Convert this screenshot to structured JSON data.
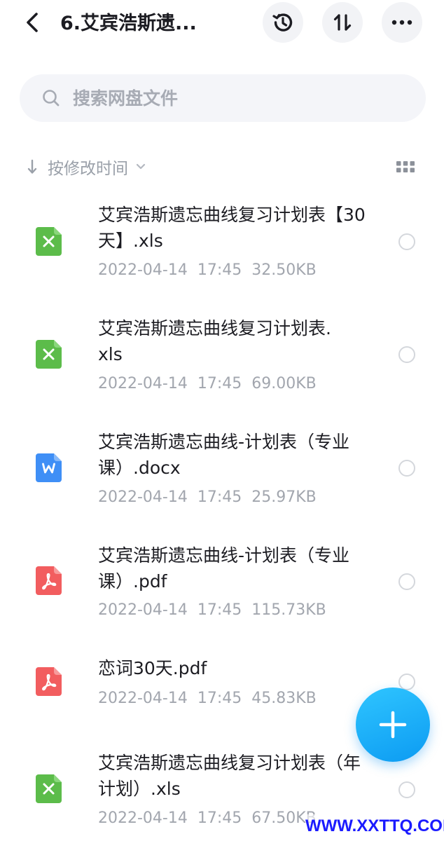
{
  "header": {
    "title": "6.艾宾浩斯遗..."
  },
  "search": {
    "placeholder": "搜索网盘文件"
  },
  "sort": {
    "label": "按修改时间"
  },
  "files": [
    {
      "name": "艾宾浩斯遗忘曲线复习计划表【30天】.xls",
      "meta": "2022-04-14  17:45  32.50KB",
      "type": "xls"
    },
    {
      "name": "艾宾浩斯遗忘曲线复习计划表.xls",
      "meta": "2022-04-14  17:45  69.00KB",
      "type": "xls"
    },
    {
      "name": "艾宾浩斯遗忘曲线-计划表（专业课）.docx",
      "meta": "2022-04-14  17:45  25.97KB",
      "type": "docx"
    },
    {
      "name": "艾宾浩斯遗忘曲线-计划表（专业课）.pdf",
      "meta": "2022-04-14  17:45  115.73KB",
      "type": "pdf"
    },
    {
      "name": "恋词30天.pdf",
      "meta": "2022-04-14  17:45  45.83KB",
      "type": "pdf"
    },
    {
      "name": "艾宾浩斯遗忘曲线复习计划表（年计划）.xls",
      "meta": "2022-04-14  17:45  67.50KB",
      "type": "xls"
    }
  ],
  "icons": {
    "back": "chevron-left-icon",
    "history": "history-icon",
    "sort": "sort-icon",
    "more": "more-icon",
    "search": "search-icon",
    "sort_arrow": "arrow-down-icon",
    "dropdown": "chevron-down-icon",
    "grid": "grid-view-icon",
    "fab": "plus-icon",
    "xls": "excel-file-icon",
    "docx": "word-file-icon",
    "pdf": "pdf-file-icon"
  },
  "colors": {
    "xls": "#5cbc4a",
    "docx": "#3f8ff6",
    "pdf": "#f25d5f",
    "fab": "#16a8f6",
    "watermark": "#1b1bff"
  },
  "watermark": "WWW.XXTTQ.COM"
}
